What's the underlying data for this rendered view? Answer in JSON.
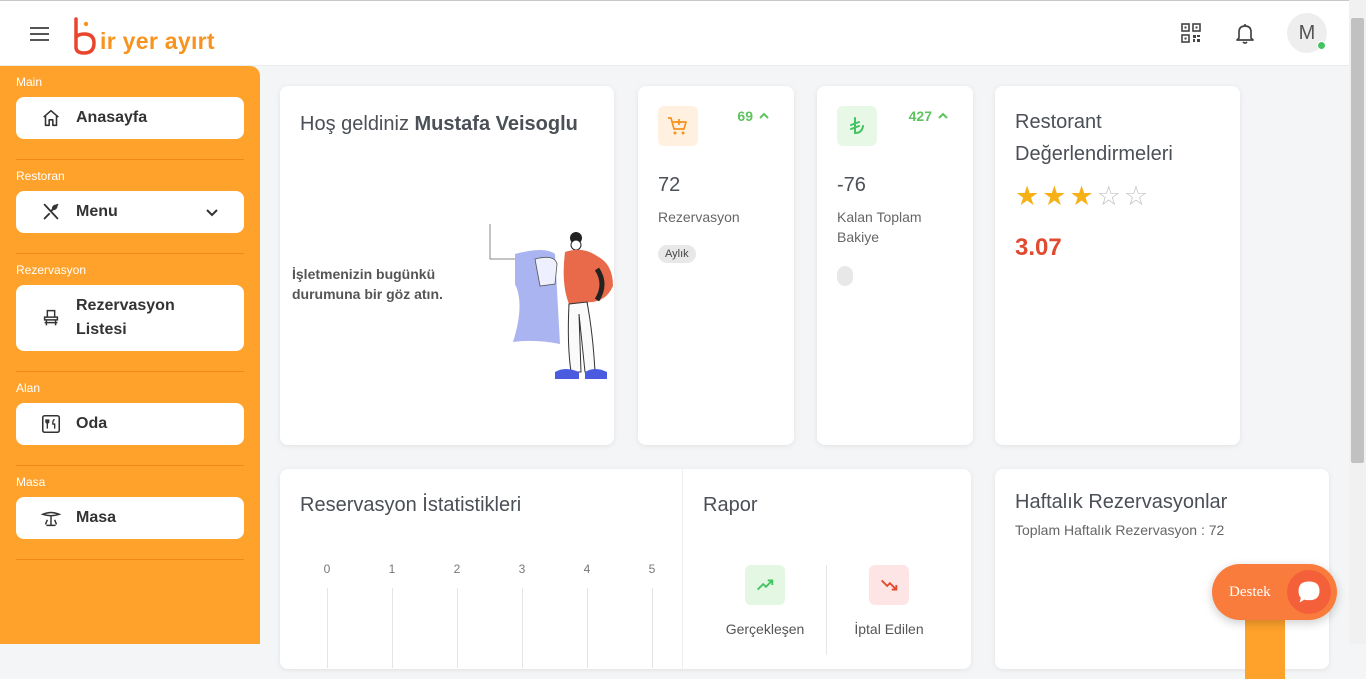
{
  "header": {
    "logo_text": "ir yer ayırt",
    "avatar_initial": "M"
  },
  "sidebar": {
    "sections": [
      {
        "title": "Main",
        "item": "Anasayfa",
        "icon": "home-icon"
      },
      {
        "title": "Restoran",
        "item": "Menu",
        "icon": "utensils-icon"
      },
      {
        "title": "Rezervasyon",
        "item": "Rezervasyon Listesi",
        "icon": "chair-icon"
      },
      {
        "title": "Alan",
        "item": "Oda",
        "icon": "room-icon"
      },
      {
        "title": "Masa",
        "item": "Masa",
        "icon": "table-icon"
      }
    ]
  },
  "welcome": {
    "greeting": "Hoş geldiniz",
    "user_name": "Mustafa Veisoglu",
    "description": "İşletmenizin bugünkü durumuna bir göz atın."
  },
  "reservation_stat": {
    "trend_value": "69",
    "value": "72",
    "label": "Rezervasyon",
    "badge": "Aylık",
    "icon": "cart-plus-icon"
  },
  "balance_stat": {
    "trend_value": "427",
    "value": "-76",
    "label": "Kalan Toplam Bakiye",
    "icon": "lira-icon"
  },
  "rating": {
    "title": "Restorant Değerlendirmeleri",
    "stars_filled": 3,
    "stars_total": 5,
    "score": "3.07"
  },
  "reservation_stats": {
    "title": "Reservasyon İstatistikleri",
    "ticks": [
      "0",
      "1",
      "2",
      "3",
      "4",
      "5"
    ]
  },
  "report": {
    "title": "Rapor",
    "realized_label": "Gerçekleşen",
    "cancelled_label": "İptal Edilen"
  },
  "weekly": {
    "title": "Haftalık Rezervasyonlar",
    "subtitle": "Toplam Haftalık Rezervasyon : 72"
  },
  "support": {
    "label": "Destek"
  },
  "colors": {
    "accent": "#ffa22b",
    "trend_green": "#5ec25e",
    "score_red": "#e04a30",
    "star": "#f6b119"
  }
}
